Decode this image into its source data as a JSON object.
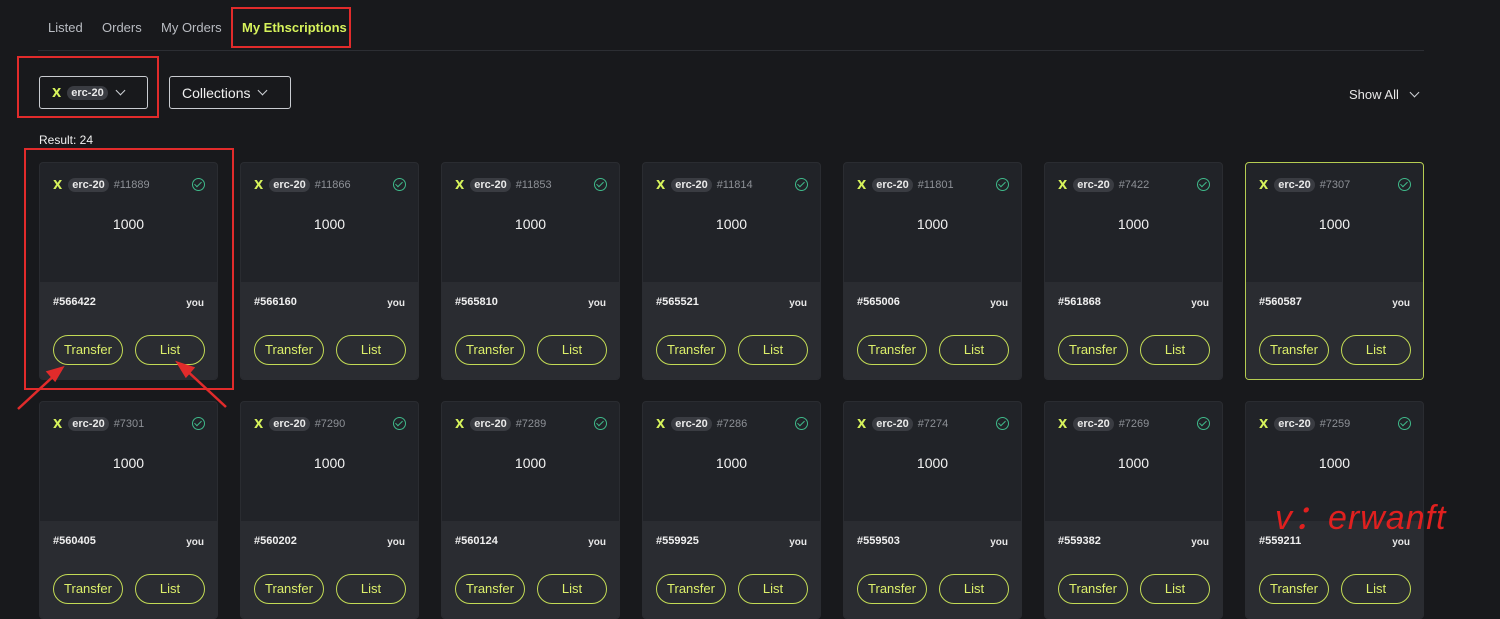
{
  "tabs": [
    "Listed",
    "Orders",
    "My Orders",
    "My Ethscriptions"
  ],
  "active_tab": "My Ethscriptions",
  "filters": {
    "token": {
      "logo": "X",
      "label": "erc-20"
    },
    "collections_label": "Collections",
    "show_all_label": "Show All"
  },
  "result_label": "Result: 24",
  "cards": [
    {
      "token": "erc-20",
      "number": "#11889",
      "amount": "1000",
      "inscription": "#566422",
      "owner": "you"
    },
    {
      "token": "erc-20",
      "number": "#11866",
      "amount": "1000",
      "inscription": "#566160",
      "owner": "you"
    },
    {
      "token": "erc-20",
      "number": "#11853",
      "amount": "1000",
      "inscription": "#565810",
      "owner": "you"
    },
    {
      "token": "erc-20",
      "number": "#11814",
      "amount": "1000",
      "inscription": "#565521",
      "owner": "you"
    },
    {
      "token": "erc-20",
      "number": "#11801",
      "amount": "1000",
      "inscription": "#565006",
      "owner": "you"
    },
    {
      "token": "erc-20",
      "number": "#7422",
      "amount": "1000",
      "inscription": "#561868",
      "owner": "you"
    },
    {
      "token": "erc-20",
      "number": "#7307",
      "amount": "1000",
      "inscription": "#560587",
      "owner": "you"
    },
    {
      "token": "erc-20",
      "number": "#7301",
      "amount": "1000",
      "inscription": "#560405",
      "owner": "you"
    },
    {
      "token": "erc-20",
      "number": "#7290",
      "amount": "1000",
      "inscription": "#560202",
      "owner": "you"
    },
    {
      "token": "erc-20",
      "number": "#7289",
      "amount": "1000",
      "inscription": "#560124",
      "owner": "you"
    },
    {
      "token": "erc-20",
      "number": "#7286",
      "amount": "1000",
      "inscription": "#559925",
      "owner": "you"
    },
    {
      "token": "erc-20",
      "number": "#7274",
      "amount": "1000",
      "inscription": "#559503",
      "owner": "you"
    },
    {
      "token": "erc-20",
      "number": "#7269",
      "amount": "1000",
      "inscription": "#559382",
      "owner": "you"
    },
    {
      "token": "erc-20",
      "number": "#7259",
      "amount": "1000",
      "inscription": "#559211",
      "owner": "you"
    }
  ],
  "card_buttons": {
    "transfer": "Transfer",
    "list": "List"
  },
  "token_logo": "X",
  "watermark": "v：erwanft",
  "colors": {
    "background": "#18191c",
    "card": "#212328",
    "accent": "#d6f25b",
    "annotation_red": "#e12b2b",
    "check_green": "#3fb98a"
  }
}
